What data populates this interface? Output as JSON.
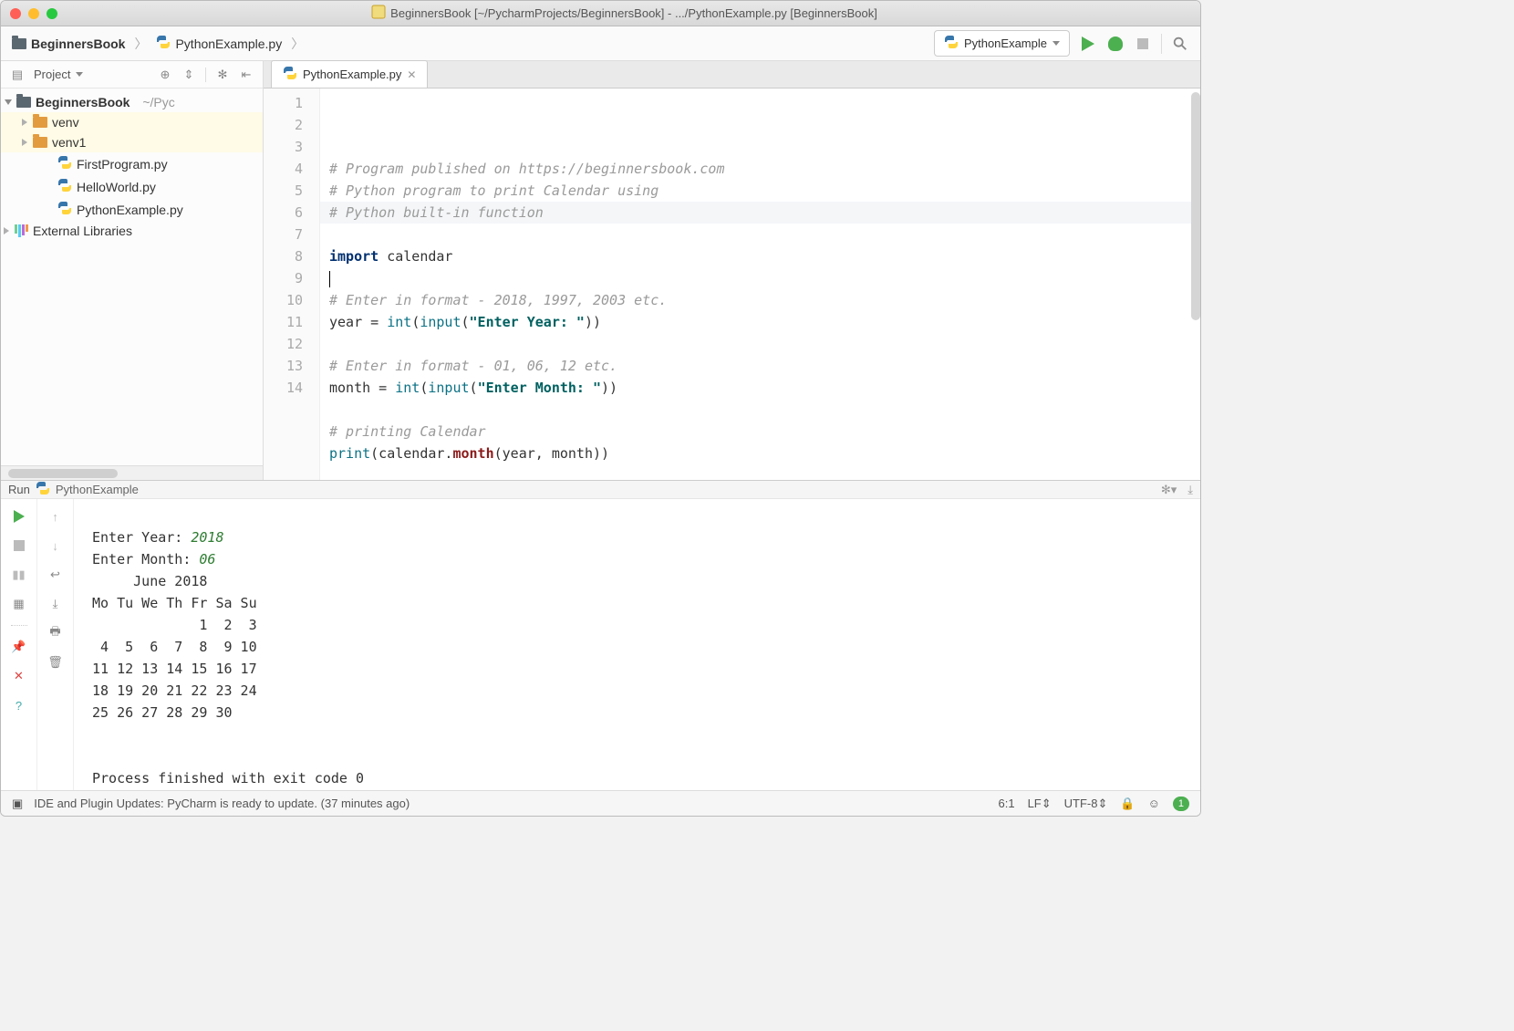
{
  "window": {
    "title": "BeginnersBook [~/PycharmProjects/BeginnersBook] - .../PythonExample.py [BeginnersBook]"
  },
  "breadcrumb": {
    "project": "BeginnersBook",
    "file": "PythonExample.py"
  },
  "runconfig": {
    "selected": "PythonExample"
  },
  "sidebar": {
    "tool_label": "Project",
    "root": "BeginnersBook",
    "root_path": "~/Pyc",
    "items": [
      "venv",
      "venv1",
      "FirstProgram.py",
      "HelloWorld.py",
      "PythonExample.py"
    ],
    "external_libs": "External Libraries"
  },
  "editor": {
    "tab": "PythonExample.py",
    "lines": {
      "1": "# Program published on https://beginnersbook.com",
      "2": "# Python program to print Calendar using",
      "3": "# Python built-in function",
      "4": "",
      "5a": "import",
      "5b": " calendar",
      "6": "",
      "7": "# Enter in format - 2018, 1997, 2003 etc.",
      "8a": "year = ",
      "8b": "int",
      "8c": "(",
      "8d": "input",
      "8e": "(",
      "8f": "\"Enter Year: \"",
      "8g": "))",
      "9": "",
      "10": "# Enter in format - 01, 06, 12 etc.",
      "11a": "month = ",
      "11b": "int",
      "11c": "(",
      "11d": "input",
      "11e": "(",
      "11f": "\"Enter Month: \"",
      "11g": "))",
      "12": "",
      "13": "# printing Calendar",
      "14a": "print",
      "14b": "(calendar.",
      "14c": "month",
      "14d": "(year, month))"
    },
    "line_numbers": [
      "1",
      "2",
      "3",
      "4",
      "5",
      "6",
      "7",
      "8",
      "9",
      "10",
      "11",
      "12",
      "13",
      "14"
    ]
  },
  "run": {
    "label": "Run",
    "name": "PythonExample",
    "output": {
      "ey_label": "Enter Year: ",
      "ey_val": "2018",
      "em_label": "Enter Month: ",
      "em_val": "06",
      "cal_title": "     June 2018",
      "cal_hdr": "Mo Tu We Th Fr Sa Su",
      "cal_r1": "             1  2  3",
      "cal_r2": " 4  5  6  7  8  9 10",
      "cal_r3": "11 12 13 14 15 16 17",
      "cal_r4": "18 19 20 21 22 23 24",
      "cal_r5": "25 26 27 28 29 30",
      "blank": "",
      "exit": "Process finished with exit code 0"
    }
  },
  "status": {
    "message": "IDE and Plugin Updates: PyCharm is ready to update. (37 minutes ago)",
    "pos": "6:1",
    "lf": "LF",
    "enc": "UTF-8",
    "badge": "1"
  }
}
